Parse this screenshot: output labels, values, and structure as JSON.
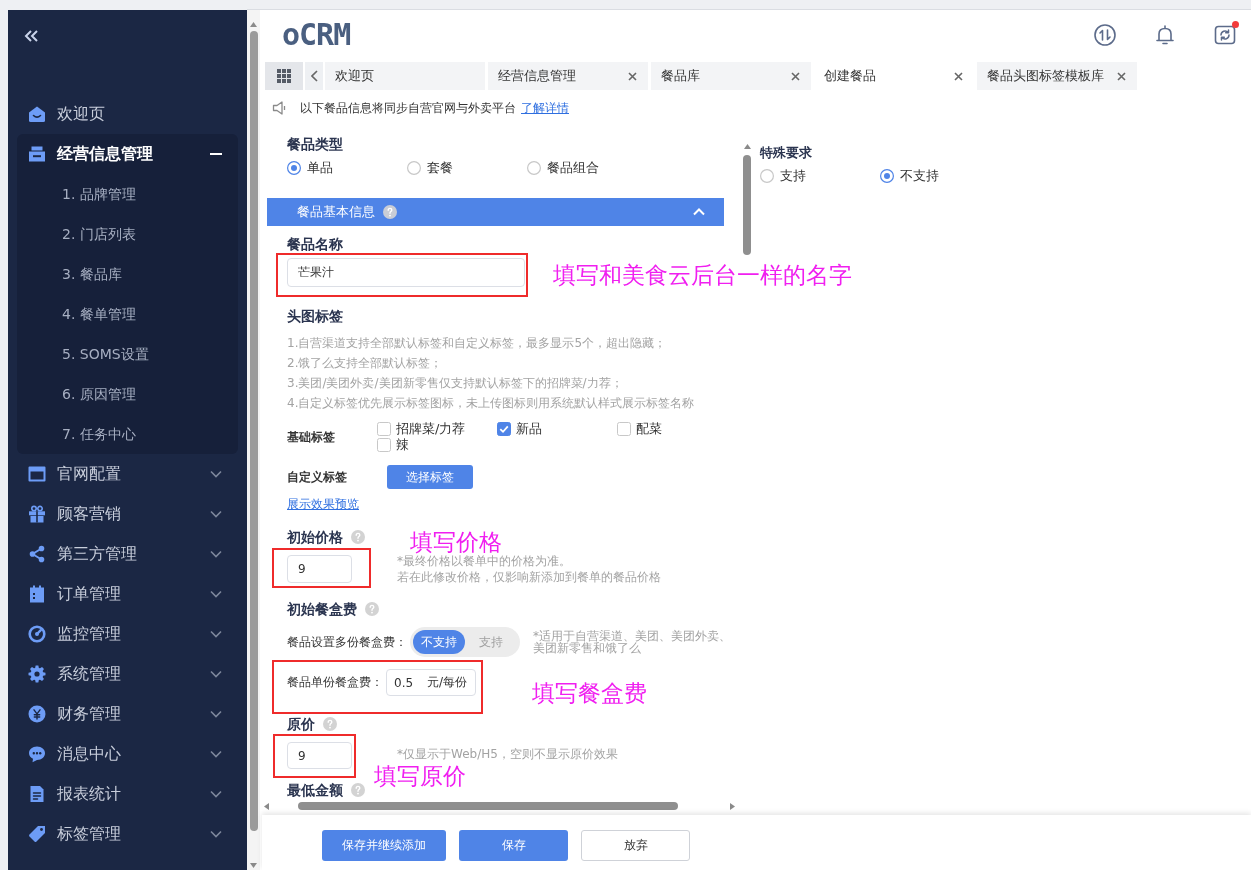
{
  "sidebar": {
    "items": [
      {
        "label": "欢迎页",
        "kind": "link"
      },
      {
        "label": "经营信息管理",
        "kind": "group",
        "expanded": true,
        "children": [
          {
            "label": "1. 品牌管理"
          },
          {
            "label": "2. 门店列表"
          },
          {
            "label": "3. 餐品库"
          },
          {
            "label": "4. 餐单管理"
          },
          {
            "label": "5. SOMS设置"
          },
          {
            "label": "6. 原因管理"
          },
          {
            "label": "7. 任务中心"
          }
        ]
      },
      {
        "label": "官网配置",
        "kind": "group",
        "expanded": false
      },
      {
        "label": "顾客营销",
        "kind": "group",
        "expanded": false
      },
      {
        "label": "第三方管理",
        "kind": "group",
        "expanded": false
      },
      {
        "label": "订单管理",
        "kind": "group",
        "expanded": false
      },
      {
        "label": "监控管理",
        "kind": "group",
        "expanded": false
      },
      {
        "label": "系统管理",
        "kind": "group",
        "expanded": false
      },
      {
        "label": "财务管理",
        "kind": "group",
        "expanded": false
      },
      {
        "label": "消息中心",
        "kind": "group",
        "expanded": false
      },
      {
        "label": "报表统计",
        "kind": "group",
        "expanded": false
      },
      {
        "label": "标签管理",
        "kind": "group",
        "expanded": false
      }
    ]
  },
  "header": {
    "logo": "oCRM",
    "actions": [
      {
        "badge": false
      },
      {
        "badge": false
      },
      {
        "badge": true
      }
    ]
  },
  "tabs": [
    {
      "label": "欢迎页",
      "closable": false,
      "selected": false
    },
    {
      "label": "经营信息管理",
      "closable": true,
      "selected": false
    },
    {
      "label": "餐品库",
      "closable": true,
      "selected": false
    },
    {
      "label": "创建餐品",
      "closable": true,
      "selected": true
    },
    {
      "label": "餐品头图标签模板库",
      "closable": true,
      "selected": false
    }
  ],
  "notice": {
    "text": "以下餐品信息将同步自营官网与外卖平台",
    "link": "了解详情"
  },
  "form": {
    "dish_type": {
      "label": "餐品类型",
      "options": [
        {
          "label": "单品",
          "selected": true
        },
        {
          "label": "套餐",
          "selected": false
        },
        {
          "label": "餐品组合",
          "selected": false
        }
      ]
    },
    "section": {
      "title": "餐品基本信息",
      "help": true,
      "expanded": true
    },
    "name_field": {
      "label": "餐品名称",
      "value": "芒果汁",
      "annotation": "填写和美食云后台一样的名字"
    },
    "image_tags": {
      "label": "头图标签",
      "notes": [
        "1.自营渠道支持全部默认标签和自定义标签，最多显示5个，超出隐藏；",
        "2.饿了么支持全部默认标签；",
        "3.美团/美团外卖/美团新零售仅支持默认标签下的招牌菜/力荐；",
        "4.自定义标签优先展示标签图标，未上传图标则用系统默认样式展示标签名称"
      ],
      "basic_label": "基础标签",
      "basic_options": [
        {
          "label": "招牌菜/力荐",
          "checked": false
        },
        {
          "label": "新品",
          "checked": true
        },
        {
          "label": "配菜",
          "checked": false
        },
        {
          "label": "辣",
          "checked": false
        }
      ],
      "custom_label": "自定义标签",
      "custom_button": "选择标签",
      "preview_link": "展示效果预览"
    },
    "price": {
      "label": "初始价格",
      "help": true,
      "value": "9",
      "notes": [
        "*最终价格以餐单中的价格为准。",
        "若在此修改价格，仅影响新添加到餐单的餐品价格"
      ],
      "annotation": "填写价格"
    },
    "box_fee": {
      "label": "初始餐盒费",
      "help": true,
      "multi_label": "餐品设置多份餐盒费：",
      "toggle": [
        {
          "label": "不支持",
          "selected": true
        },
        {
          "label": "支持",
          "selected": false
        }
      ],
      "note": "*适用于自营渠道、美团、美团外卖、美团新零售和饿了么",
      "unit_label": "餐品单份餐盒费：",
      "value": "0.5",
      "unit": "元/每份",
      "annotation": "填写餐盒费"
    },
    "original_price": {
      "label": "原价",
      "help": true,
      "value": "9",
      "note": "*仅显示于Web/H5，空则不显示原价效果",
      "annotation": "填写原价"
    },
    "min_amount": {
      "label": "最低金额",
      "help": true
    }
  },
  "special": {
    "label": "特殊要求",
    "options": [
      {
        "label": "支持",
        "selected": false
      },
      {
        "label": "不支持",
        "selected": true
      }
    ]
  },
  "footer": {
    "buttons": [
      {
        "label": "保存并继续添加",
        "kind": "primary"
      },
      {
        "label": "保存",
        "kind": "primary"
      },
      {
        "label": "放弃",
        "kind": "default"
      }
    ]
  }
}
